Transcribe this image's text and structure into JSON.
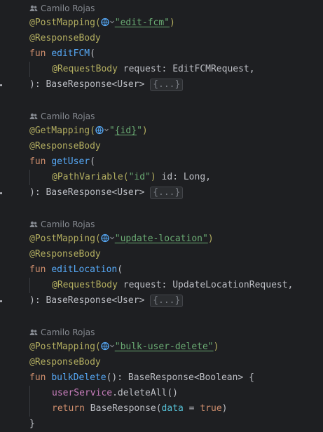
{
  "author": "Camilo Rojas",
  "colors": {
    "background": "#1e1f22",
    "annotation": "#b3ae60",
    "keyword": "#cf8e6d",
    "function": "#56a8f5",
    "string": "#6aab73",
    "property": "#c77dbb"
  },
  "blocks": [
    {
      "annotation": "@PostMapping(",
      "path": "\"edit-fcm\"",
      "annotation_close": ")",
      "body_annotation": "@ResponseBody",
      "fun_kw": "fun ",
      "fun_name": "editFCM",
      "fun_open": "(",
      "param_annotation": "@RequestBody",
      "param_text": " request: EditFCMRequest,",
      "close": "): BaseResponse<User> ",
      "fold": "{...}"
    },
    {
      "annotation": "@GetMapping(",
      "path_q1": "\"",
      "path_ul": "{id}",
      "path_q2": "\"",
      "annotation_close": ")",
      "body_annotation": "@ResponseBody",
      "fun_kw": "fun ",
      "fun_name": "getUser",
      "fun_open": "(",
      "param_annotation": "@PathVariable(",
      "param_value": "\"id\"",
      "param_annotation_close": ")",
      "param_text": " id: Long,",
      "close": "): BaseResponse<User> ",
      "fold": "{...}"
    },
    {
      "annotation": "@PostMapping(",
      "path": "\"update-location\"",
      "annotation_close": ")",
      "body_annotation": "@ResponseBody",
      "fun_kw": "fun ",
      "fun_name": "editLocation",
      "fun_open": "(",
      "param_annotation": "@RequestBody",
      "param_text": " request: UpdateLocationRequest,",
      "close": "): BaseResponse<User> ",
      "fold": "{...}"
    },
    {
      "annotation": "@PostMapping(",
      "path": "\"bulk-user-delete\"",
      "annotation_close": ")",
      "body_annotation": "@ResponseBody",
      "fun_kw": "fun ",
      "fun_name": "bulkDelete",
      "fun_signature": "(): BaseResponse<Boolean> {",
      "stmt1_obj": "userService",
      "stmt1_call": ".deleteAll()",
      "stmt2_kw": "return ",
      "stmt2_call": "BaseResponse(",
      "stmt2_named": "data",
      "stmt2_eq": " = ",
      "stmt2_val": "true",
      "stmt2_close": ")",
      "close_brace": "}"
    }
  ]
}
